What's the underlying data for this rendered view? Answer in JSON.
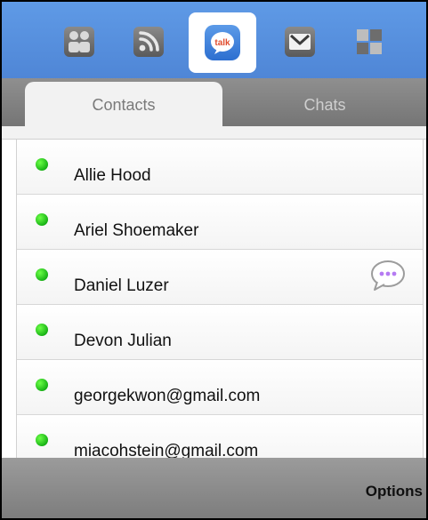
{
  "appbar": {
    "apps": [
      {
        "icon": "myspace-icon"
      },
      {
        "icon": "rss-icon"
      },
      {
        "icon": "talk-icon",
        "label": "talk",
        "selected": true
      },
      {
        "icon": "gmail-icon"
      },
      {
        "icon": "apps-grid-icon"
      }
    ]
  },
  "tabs": {
    "contacts": "Contacts",
    "chats": "Chats"
  },
  "contacts": [
    {
      "name": "Allie Hood"
    },
    {
      "name": "Ariel Shoemaker"
    },
    {
      "name": "Daniel Luzer"
    },
    {
      "name": "Devon Julian"
    },
    {
      "name": "georgekwon@gmail.com"
    },
    {
      "name": "miacohstein@gmail.com"
    }
  ],
  "bottom": {
    "options_label": "Options"
  },
  "colors": {
    "appbar_blue": "#5f9ae6",
    "status_online": "#19b316",
    "bubble_purple": "#b57bf2"
  }
}
